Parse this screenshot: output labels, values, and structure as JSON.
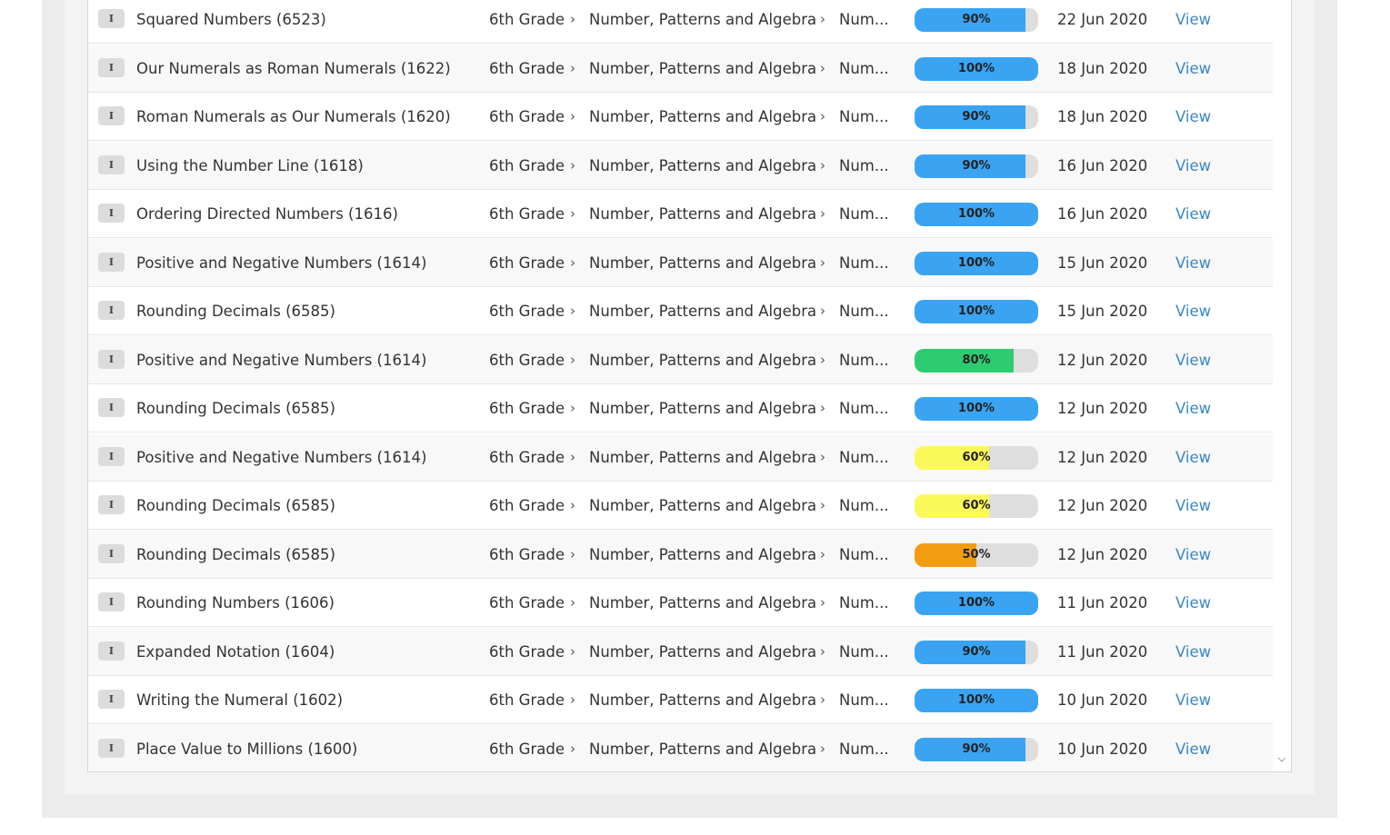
{
  "colors": {
    "blue": "#3aa4f2",
    "green": "#2ecc71",
    "yellow": "#fbf95a",
    "orange": "#f39c12",
    "track": "#dedede",
    "link": "#3a87c8"
  },
  "icons": {
    "scroll_down": "chevron-down-icon",
    "separator": "chevron-right-icon"
  },
  "activities": [
    {
      "type": "I",
      "title": "Squared Numbers (6523)",
      "grade": "6th Grade",
      "strand": "Number, Patterns and Algebra",
      "topic": "Num...",
      "score": 90,
      "score_label": "90%",
      "color": "blue",
      "date": "22 Jun 2020",
      "action": "View"
    },
    {
      "type": "I",
      "title": "Our Numerals as Roman Numerals (1622)",
      "grade": "6th Grade",
      "strand": "Number, Patterns and Algebra",
      "topic": "Num...",
      "score": 100,
      "score_label": "100%",
      "color": "blue",
      "date": "18 Jun 2020",
      "action": "View"
    },
    {
      "type": "I",
      "title": "Roman Numerals as Our Numerals (1620)",
      "grade": "6th Grade",
      "strand": "Number, Patterns and Algebra",
      "topic": "Num...",
      "score": 90,
      "score_label": "90%",
      "color": "blue",
      "date": "18 Jun 2020",
      "action": "View"
    },
    {
      "type": "I",
      "title": "Using the Number Line (1618)",
      "grade": "6th Grade",
      "strand": "Number, Patterns and Algebra",
      "topic": "Num...",
      "score": 90,
      "score_label": "90%",
      "color": "blue",
      "date": "16 Jun 2020",
      "action": "View"
    },
    {
      "type": "I",
      "title": "Ordering Directed Numbers (1616)",
      "grade": "6th Grade",
      "strand": "Number, Patterns and Algebra",
      "topic": "Num...",
      "score": 100,
      "score_label": "100%",
      "color": "blue",
      "date": "16 Jun 2020",
      "action": "View"
    },
    {
      "type": "I",
      "title": "Positive and Negative Numbers (1614)",
      "grade": "6th Grade",
      "strand": "Number, Patterns and Algebra",
      "topic": "Num...",
      "score": 100,
      "score_label": "100%",
      "color": "blue",
      "date": "15 Jun 2020",
      "action": "View"
    },
    {
      "type": "I",
      "title": "Rounding Decimals (6585)",
      "grade": "6th Grade",
      "strand": "Number, Patterns and Algebra",
      "topic": "Num...",
      "score": 100,
      "score_label": "100%",
      "color": "blue",
      "date": "15 Jun 2020",
      "action": "View"
    },
    {
      "type": "I",
      "title": "Positive and Negative Numbers (1614)",
      "grade": "6th Grade",
      "strand": "Number, Patterns and Algebra",
      "topic": "Num...",
      "score": 80,
      "score_label": "80%",
      "color": "green",
      "date": "12 Jun 2020",
      "action": "View"
    },
    {
      "type": "I",
      "title": "Rounding Decimals (6585)",
      "grade": "6th Grade",
      "strand": "Number, Patterns and Algebra",
      "topic": "Num...",
      "score": 100,
      "score_label": "100%",
      "color": "blue",
      "date": "12 Jun 2020",
      "action": "View"
    },
    {
      "type": "I",
      "title": "Positive and Negative Numbers (1614)",
      "grade": "6th Grade",
      "strand": "Number, Patterns and Algebra",
      "topic": "Num...",
      "score": 60,
      "score_label": "60%",
      "color": "yellow",
      "date": "12 Jun 2020",
      "action": "View"
    },
    {
      "type": "I",
      "title": "Rounding Decimals (6585)",
      "grade": "6th Grade",
      "strand": "Number, Patterns and Algebra",
      "topic": "Num...",
      "score": 60,
      "score_label": "60%",
      "color": "yellow",
      "date": "12 Jun 2020",
      "action": "View"
    },
    {
      "type": "I",
      "title": "Rounding Decimals (6585)",
      "grade": "6th Grade",
      "strand": "Number, Patterns and Algebra",
      "topic": "Num...",
      "score": 50,
      "score_label": "50%",
      "color": "orange",
      "date": "12 Jun 2020",
      "action": "View"
    },
    {
      "type": "I",
      "title": "Rounding Numbers (1606)",
      "grade": "6th Grade",
      "strand": "Number, Patterns and Algebra",
      "topic": "Num...",
      "score": 100,
      "score_label": "100%",
      "color": "blue",
      "date": "11 Jun 2020",
      "action": "View"
    },
    {
      "type": "I",
      "title": "Expanded Notation (1604)",
      "grade": "6th Grade",
      "strand": "Number, Patterns and Algebra",
      "topic": "Num...",
      "score": 90,
      "score_label": "90%",
      "color": "blue",
      "date": "11 Jun 2020",
      "action": "View"
    },
    {
      "type": "I",
      "title": "Writing the Numeral (1602)",
      "grade": "6th Grade",
      "strand": "Number, Patterns and Algebra",
      "topic": "Num...",
      "score": 100,
      "score_label": "100%",
      "color": "blue",
      "date": "10 Jun 2020",
      "action": "View"
    },
    {
      "type": "I",
      "title": "Place Value to Millions (1600)",
      "grade": "6th Grade",
      "strand": "Number, Patterns and Algebra",
      "topic": "Num...",
      "score": 90,
      "score_label": "90%",
      "color": "blue",
      "date": "10 Jun 2020",
      "action": "View"
    }
  ]
}
